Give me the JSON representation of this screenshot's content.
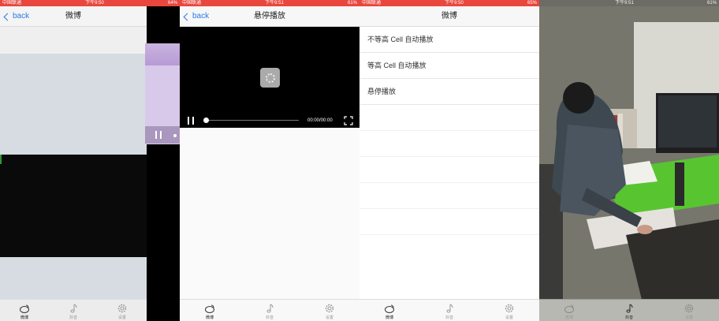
{
  "panels": [
    {
      "status": {
        "carrier": "中国联通",
        "time": "下午9:50",
        "battery": "64%"
      },
      "nav": {
        "back": "back",
        "title": "微博"
      },
      "tabs": [
        {
          "label": "微博"
        },
        {
          "label": "抖音"
        },
        {
          "label": "设置"
        }
      ]
    },
    {
      "status": {
        "carrier": "中国联通",
        "time": "下午9:51",
        "battery": "61%"
      },
      "nav": {
        "back": "back",
        "title": "悬停播放"
      },
      "video": {
        "time": "00:00/00:00",
        "progress": 0
      },
      "tabs": [
        {
          "label": "微博"
        },
        {
          "label": "抖音"
        },
        {
          "label": "设置"
        }
      ]
    },
    {
      "status": {
        "carrier": "中国联通",
        "time": "下午9:50",
        "battery": "65%"
      },
      "nav": {
        "title": "微博"
      },
      "list": [
        "不等高 Cell 自动播放",
        "等高 Cell 自动播放",
        "悬停播放"
      ],
      "tabs": [
        {
          "label": "微博"
        },
        {
          "label": "抖音"
        },
        {
          "label": "设置"
        }
      ]
    },
    {
      "status": {
        "carrier": "",
        "time": "下午9:51",
        "battery": "61%"
      },
      "tabs": [
        {
          "label": "微博"
        },
        {
          "label": "抖音"
        },
        {
          "label": "设置"
        }
      ]
    }
  ],
  "colors": {
    "statusbar": "#e9473d",
    "link": "#2a7ae2"
  }
}
